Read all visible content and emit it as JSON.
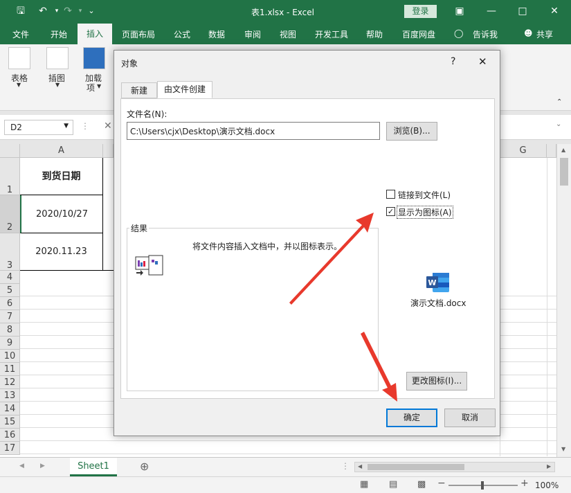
{
  "window": {
    "title": "表1.xlsx  -  Excel",
    "login_label": "登录"
  },
  "tabs": [
    "文件",
    "开始",
    "插入",
    "页面布局",
    "公式",
    "数据",
    "审阅",
    "视图",
    "开发工具",
    "帮助",
    "百度网盘",
    "告诉我",
    "共享"
  ],
  "ribbon": {
    "table_label": "表格",
    "illustration_label": "插图",
    "addin_label": "加载",
    "addin_label2": "项"
  },
  "formula_bar": {
    "name_box": "D2"
  },
  "grid": {
    "columns": [
      "A",
      "G"
    ],
    "rows": [
      "1",
      "2",
      "3",
      "4",
      "5",
      "6",
      "7",
      "8",
      "9",
      "10",
      "11",
      "12",
      "13",
      "14",
      "15",
      "16",
      "17"
    ],
    "cells": {
      "A1": "到货日期",
      "A2": "2020/10/27",
      "A3": "2020.11.23"
    }
  },
  "sheet": {
    "tab_label": "Sheet1",
    "zoom": "100%"
  },
  "dialog": {
    "title": "对象",
    "help": "?",
    "close": "✕",
    "tab_new": "新建",
    "tab_from_file": "由文件创建",
    "filename_label": "文件名(N):",
    "filename_value": "C:\\Users\\cjx\\Desktop\\演示文档.docx",
    "browse_label": "浏览(B)...",
    "link_label": "链接到文件(L)",
    "link_checked": false,
    "display_icon_label": "显示为图标(A)",
    "display_icon_checked": true,
    "result_label": "结果",
    "result_text": "将文件内容插入文档中，并以图标表示。",
    "icon_caption": "演示文档.docx",
    "change_icon_label": "更改图标(I)...",
    "ok_label": "确定",
    "cancel_label": "取消"
  },
  "colors": {
    "excel_green": "#217346",
    "arrow_red": "#e8392c",
    "word_blue": "#2b579a"
  }
}
